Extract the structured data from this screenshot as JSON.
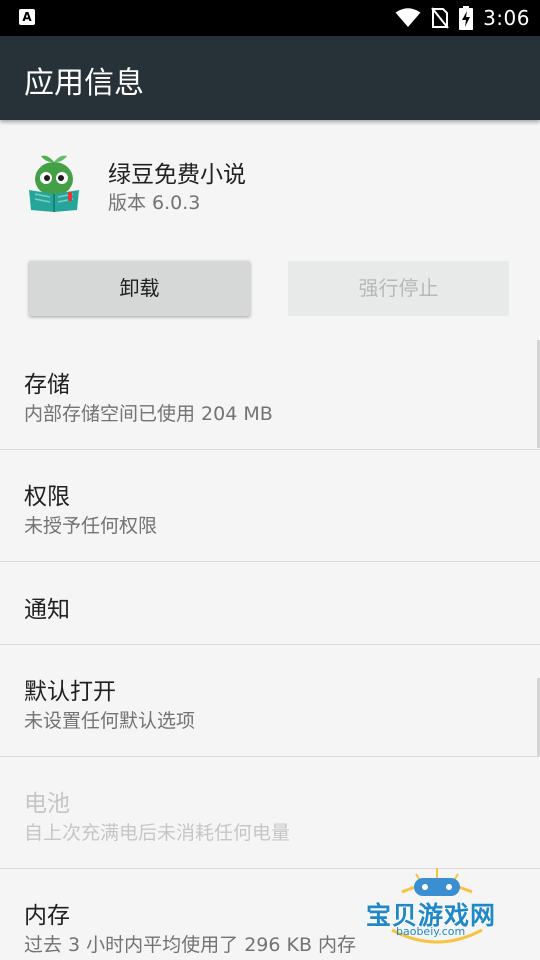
{
  "status_bar": {
    "left_icon": "A",
    "time": "3:06",
    "icons": [
      "wifi-icon",
      "no-sim-icon",
      "battery-charging-icon"
    ]
  },
  "app_bar": {
    "title": "应用信息"
  },
  "app": {
    "name": "绿豆免费小说",
    "version": "版本 6.0.3",
    "icon": "green-bean-book-app-icon"
  },
  "buttons": {
    "uninstall": "卸载",
    "force_stop": "强行停止"
  },
  "settings": [
    {
      "title": "存储",
      "summary": "内部存储空间已使用 204 MB",
      "enabled": true
    },
    {
      "title": "权限",
      "summary": "未授予任何权限",
      "enabled": true
    },
    {
      "title": "通知",
      "summary": "",
      "enabled": true
    },
    {
      "title": "默认打开",
      "summary": "未设置任何默认选项",
      "enabled": true
    },
    {
      "title": "电池",
      "summary": "自上次充满电后未消耗任何电量",
      "enabled": false
    },
    {
      "title": "内存",
      "summary": "过去 3 小时内平均使用了 296 KB 内存",
      "enabled": true
    }
  ],
  "watermark": {
    "text": "宝贝游戏网",
    "url": "baobeiy.com"
  },
  "colors": {
    "app_bar": "#263238",
    "status_bar": "#000000",
    "background": "#f5f5f5",
    "primary_text": "#212121",
    "secondary_text": "#737373",
    "disabled_text": "#c6c6c6"
  }
}
